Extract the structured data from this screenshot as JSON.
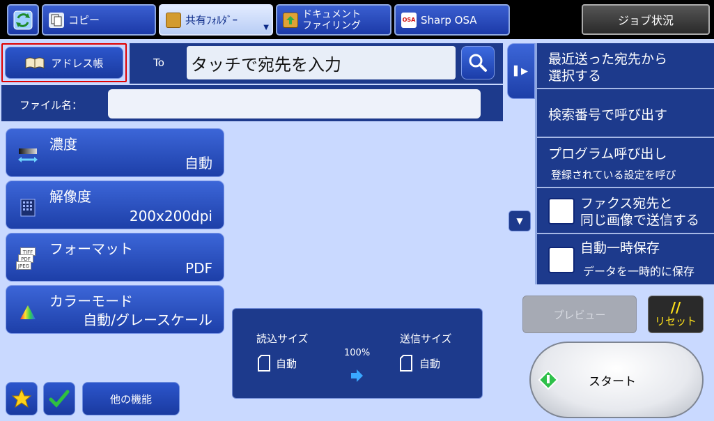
{
  "tabs": {
    "copy": "コピー",
    "shared_folder": "共有ﾌｫﾙﾀﾞｰ",
    "doc_filing_1": "ドキュメント",
    "doc_filing_2": "ファイリング",
    "sharp_osa": "Sharp OSA",
    "osa_logo": "OSA"
  },
  "job_status": "ジョブ状況",
  "address": {
    "address_book": "アドレス帳",
    "to_label": "To",
    "to_input": "タッチで宛先を入力"
  },
  "filename": {
    "label": "ファイル名：",
    "value": ""
  },
  "settings": [
    {
      "title": "濃度",
      "value": "自動"
    },
    {
      "title": "解像度",
      "value": "200x200dpi"
    },
    {
      "title": "フォーマット",
      "value": "PDF"
    },
    {
      "title": "カラーモード",
      "value": "自動/グレースケール"
    }
  ],
  "format_icon": {
    "tiff": "TIFF",
    "pdf": "PDF",
    "jpeg": "JPEG"
  },
  "info": {
    "scan_size_label": "読込サイズ",
    "scan_size_value": "自動",
    "ratio": "100%",
    "send_size_label": "送信サイズ",
    "send_size_value": "自動"
  },
  "bottom": {
    "other_functions": "他の機能"
  },
  "right_menu": {
    "recent_1": "最近送った宛先から",
    "recent_2": "選択する",
    "search_number": "検索番号で呼び出す",
    "program": "プログラム呼び出し",
    "program_sub": "登録されている設定を呼び",
    "fax_1": "ファクス宛先と",
    "fax_2": "同じ画像で送信する",
    "autosave_1": "自動一時保存",
    "autosave_2": "データを一時的に保存"
  },
  "actions": {
    "preview": "プレビュー",
    "reset_glyph": "//",
    "reset": "リセット",
    "start": "スタート"
  }
}
